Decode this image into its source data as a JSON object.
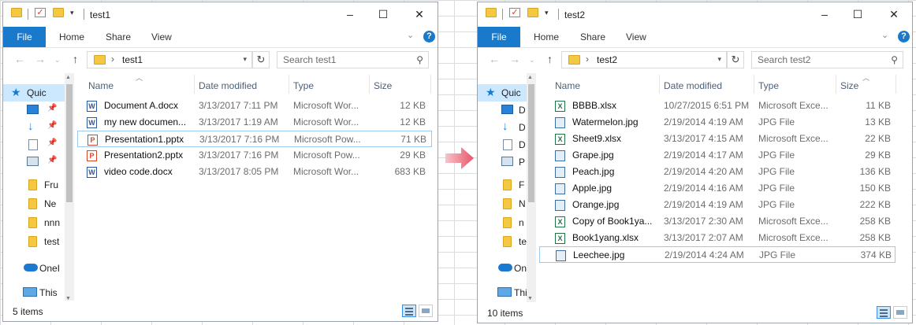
{
  "left_window": {
    "title": "test1",
    "ribbon": {
      "file": "File",
      "tabs": [
        "Home",
        "Share",
        "View"
      ],
      "help": "?"
    },
    "address": {
      "path": "test1"
    },
    "search": {
      "placeholder": "Search test1"
    },
    "nav_items": [
      {
        "label": "Quic",
        "icon": "star-icon"
      },
      {
        "label": "",
        "icon": "desktop-icon"
      },
      {
        "label": "",
        "icon": "downloads-icon"
      },
      {
        "label": "",
        "icon": "documents-icon"
      },
      {
        "label": "",
        "icon": "pictures-icon"
      },
      {
        "label": "Fru",
        "icon": "folder-icon"
      },
      {
        "label": "Ne",
        "icon": "folder-icon"
      },
      {
        "label": "nnn",
        "icon": "folder-icon"
      },
      {
        "label": "test",
        "icon": "folder-icon"
      },
      {
        "label": "OneI",
        "icon": "onedrive-icon"
      },
      {
        "label": "This",
        "icon": "this-pc-icon"
      }
    ],
    "columns": {
      "name": "Name",
      "date": "Date modified",
      "type": "Type",
      "size": "Size"
    },
    "files": [
      {
        "name": "Document A.docx",
        "date": "3/13/2017 7:11 PM",
        "type": "Microsoft Wor...",
        "size": "12 KB",
        "icon": "word-icon"
      },
      {
        "name": "my new documen...",
        "date": "3/13/2017 1:19 AM",
        "type": "Microsoft Wor...",
        "size": "12 KB",
        "icon": "word-icon"
      },
      {
        "name": "Presentation1.pptx",
        "date": "3/13/2017 7:16 PM",
        "type": "Microsoft Pow...",
        "size": "71 KB",
        "icon": "powerpoint-icon",
        "selected": true
      },
      {
        "name": "Presentation2.pptx",
        "date": "3/13/2017 7:16 PM",
        "type": "Microsoft Pow...",
        "size": "29 KB",
        "icon": "powerpoint-icon"
      },
      {
        "name": "video code.docx",
        "date": "3/13/2017 8:05 PM",
        "type": "Microsoft Wor...",
        "size": "683 KB",
        "icon": "word-icon"
      }
    ],
    "status": "5 items"
  },
  "right_window": {
    "title": "test2",
    "ribbon": {
      "file": "File",
      "tabs": [
        "Home",
        "Share",
        "View"
      ],
      "help": "?"
    },
    "address": {
      "path": "test2"
    },
    "search": {
      "placeholder": "Search test2"
    },
    "nav_items": [
      {
        "label": "Quic",
        "icon": "star-icon"
      },
      {
        "label": "D",
        "icon": "desktop-icon"
      },
      {
        "label": "D",
        "icon": "downloads-icon"
      },
      {
        "label": "D",
        "icon": "documents-icon"
      },
      {
        "label": "P",
        "icon": "pictures-icon"
      },
      {
        "label": "F",
        "icon": "folder-icon"
      },
      {
        "label": "N",
        "icon": "folder-icon"
      },
      {
        "label": "n",
        "icon": "folder-icon"
      },
      {
        "label": "te",
        "icon": "folder-icon"
      },
      {
        "label": "On",
        "icon": "onedrive-icon"
      },
      {
        "label": "Thi",
        "icon": "this-pc-icon"
      }
    ],
    "columns": {
      "name": "Name",
      "date": "Date modified",
      "type": "Type",
      "size": "Size"
    },
    "files": [
      {
        "name": "BBBB.xlsx",
        "date": "10/27/2015 6:51 PM",
        "type": "Microsoft Exce...",
        "size": "11 KB",
        "icon": "excel-icon"
      },
      {
        "name": "Watermelon.jpg",
        "date": "2/19/2014 4:19 AM",
        "type": "JPG File",
        "size": "13 KB",
        "icon": "jpg-icon"
      },
      {
        "name": "Sheet9.xlsx",
        "date": "3/13/2017 4:15 AM",
        "type": "Microsoft Exce...",
        "size": "22 KB",
        "icon": "excel-icon"
      },
      {
        "name": "Grape.jpg",
        "date": "2/19/2014 4:17 AM",
        "type": "JPG File",
        "size": "29 KB",
        "icon": "jpg-icon"
      },
      {
        "name": "Peach.jpg",
        "date": "2/19/2014 4:20 AM",
        "type": "JPG File",
        "size": "136 KB",
        "icon": "jpg-icon"
      },
      {
        "name": "Apple.jpg",
        "date": "2/19/2014 4:16 AM",
        "type": "JPG File",
        "size": "150 KB",
        "icon": "jpg-icon"
      },
      {
        "name": "Orange.jpg",
        "date": "2/19/2014 4:19 AM",
        "type": "JPG File",
        "size": "222 KB",
        "icon": "jpg-icon"
      },
      {
        "name": "Copy of Book1ya...",
        "date": "3/13/2017 2:30 AM",
        "type": "Microsoft Exce...",
        "size": "258 KB",
        "icon": "excel-icon"
      },
      {
        "name": "Book1yang.xlsx",
        "date": "3/13/2017 2:07 AM",
        "type": "Microsoft Exce...",
        "size": "258 KB",
        "icon": "excel-icon"
      },
      {
        "name": "Leechee.jpg",
        "date": "2/19/2014 4:24 AM",
        "type": "JPG File",
        "size": "374 KB",
        "icon": "jpg-icon",
        "selected": true
      }
    ],
    "status": "10 items"
  },
  "colors": {
    "accent": "#1979ca",
    "arrow": "#e8566a",
    "selection_border": "#99c9ef"
  }
}
